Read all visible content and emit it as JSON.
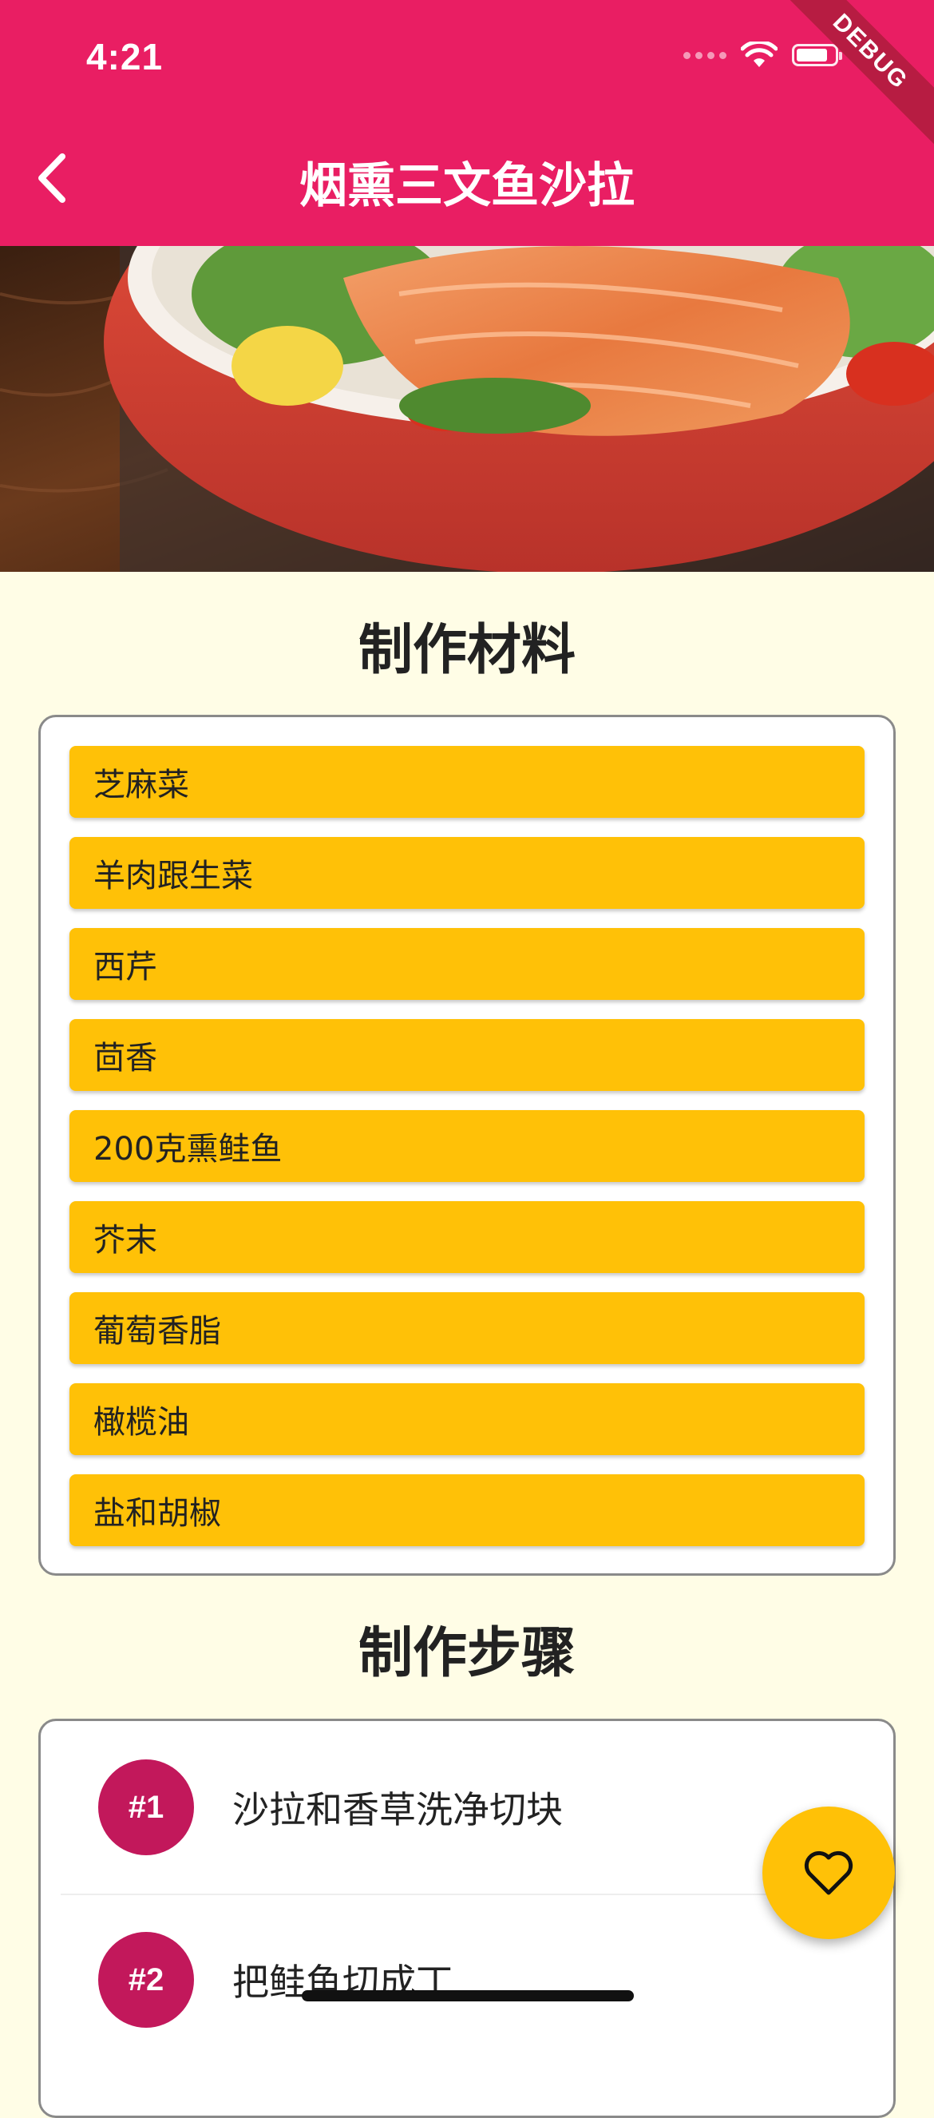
{
  "status_bar": {
    "time": "4:21",
    "debug_label": "DEBUG"
  },
  "app_bar": {
    "title": "烟熏三文鱼沙拉",
    "back_icon": "chevron-left-icon"
  },
  "hero": {
    "icon": "salmon-salad-photo"
  },
  "ingredients": {
    "heading": "制作材料",
    "items": [
      "芝麻菜",
      "羊肉跟生菜",
      "西芹",
      "茴香",
      "200克熏鲑鱼",
      "芥末",
      "葡萄香脂",
      "橄榄油",
      "盐和胡椒"
    ]
  },
  "steps": {
    "heading": "制作步骤",
    "items": [
      {
        "badge": "#1",
        "text": "沙拉和香草洗净切块"
      },
      {
        "badge": "#2",
        "text": "把鲑鱼切成丁"
      }
    ]
  },
  "fab": {
    "icon": "heart-icon"
  },
  "colors": {
    "primary": "#E91E63",
    "accent": "#FFC107",
    "badge": "#C2185B",
    "background": "#FFFDE6"
  }
}
